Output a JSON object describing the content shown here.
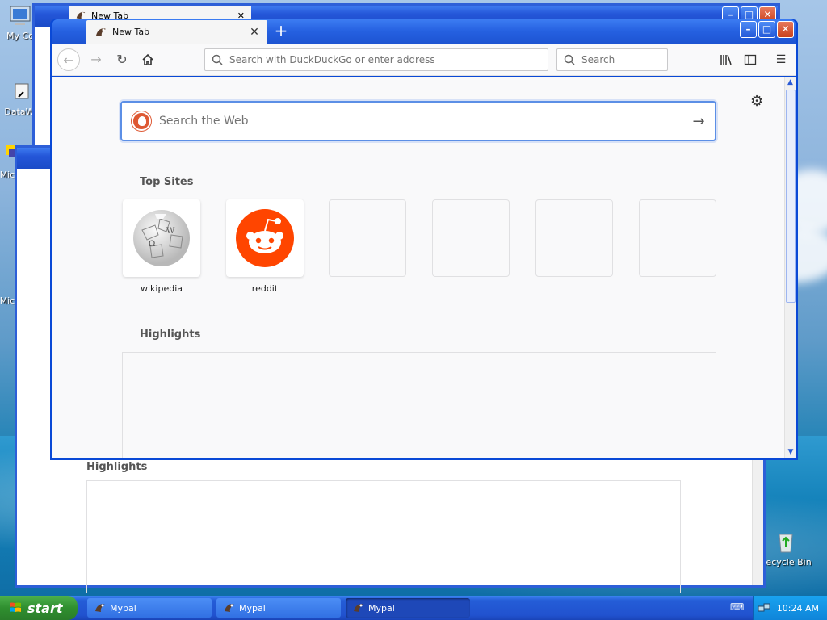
{
  "desktop": {
    "icons": [
      {
        "label": "My Co"
      },
      {
        "label": "DataWa"
      },
      {
        "label": "Mic"
      },
      {
        "label": "Mic"
      },
      {
        "label": "Recycle Bin"
      }
    ]
  },
  "background_windows": {
    "tab_title": "New Tab",
    "highlights_label": "Highlights"
  },
  "window": {
    "tab": {
      "title": "New Tab",
      "close": "✕"
    },
    "new_tab": "+",
    "buttons": {
      "minimize": "–",
      "maximize": "□",
      "close": "✕"
    }
  },
  "toolbar": {
    "url_placeholder": "Search with DuckDuckGo or enter address",
    "search_placeholder": "Search"
  },
  "newtab_page": {
    "search_placeholder": "Search the Web",
    "top_sites_title": "Top Sites",
    "top_sites": [
      {
        "label": "wikipedia"
      },
      {
        "label": "reddit"
      },
      {
        "label": ""
      },
      {
        "label": ""
      },
      {
        "label": ""
      },
      {
        "label": ""
      }
    ],
    "highlights_title": "Highlights"
  },
  "taskbar": {
    "start_label": "start",
    "tasks": [
      {
        "label": "Mypal"
      },
      {
        "label": "Mypal"
      },
      {
        "label": "Mypal"
      }
    ],
    "clock": "10:24 AM"
  },
  "colors": {
    "xp_blue": "#0a49d6",
    "start_green": "#2f8f2f",
    "reddit_orange": "#ff4500",
    "ddg_orange": "#de5833"
  }
}
